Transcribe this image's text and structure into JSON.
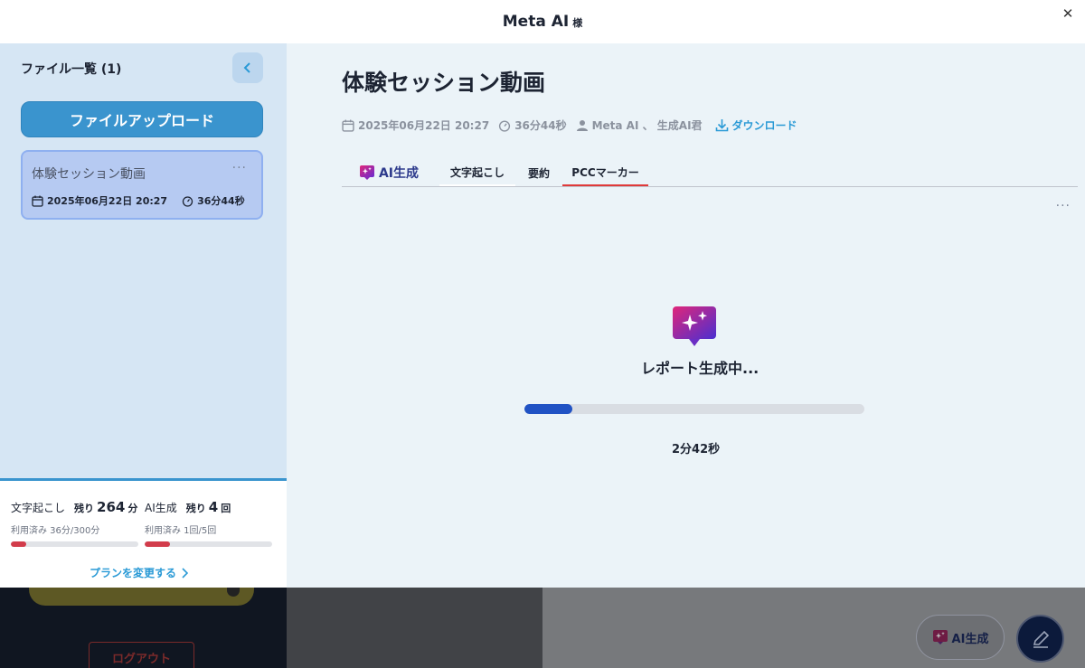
{
  "window": {
    "title": "Meta AI",
    "title_suffix": "様",
    "close_icon": "close-icon"
  },
  "sidebar": {
    "heading": "ファイル一覧 (1)",
    "upload_label": "ファイルアップロード",
    "files": [
      {
        "name": "体験セッション動画",
        "date": "2025年06月22日 20:27",
        "duration": "36分44秒",
        "more": "···"
      }
    ]
  },
  "usage": {
    "transcription": {
      "label": "文字起こし",
      "remaining_prefix": "残り",
      "remaining_value": "264",
      "remaining_unit": "分",
      "used_text": "利用済み 36分/300分",
      "used_fraction": 0.12
    },
    "ai": {
      "label": "AI生成",
      "remaining_prefix": "残り",
      "remaining_value": "4",
      "remaining_unit": "回",
      "used_text": "利用済み 1回/5回",
      "used_fraction": 0.2
    },
    "plan_link": "プランを変更する"
  },
  "main": {
    "title": "体験セッション動画",
    "date": "2025年06月22日 20:27",
    "duration": "36分44秒",
    "participants": "Meta AI 、 生成AI君",
    "download": "ダウンロード",
    "tabs": {
      "ai": "AI生成",
      "transcript": "文字起こし",
      "summary": "要約",
      "pcc": "PCCマーカー"
    },
    "more": "···",
    "generating_text": "レポート生成中...",
    "progress_fraction": 0.14,
    "timer": "2分42秒"
  },
  "background": {
    "logout": "ログアウト"
  },
  "floating": {
    "ai_label": "AI生成"
  },
  "colors": {
    "accent": "#3a94ce",
    "progress": "#2052c4",
    "usage_bar": "#d23c4b",
    "active_tab": "#e03a3a"
  }
}
